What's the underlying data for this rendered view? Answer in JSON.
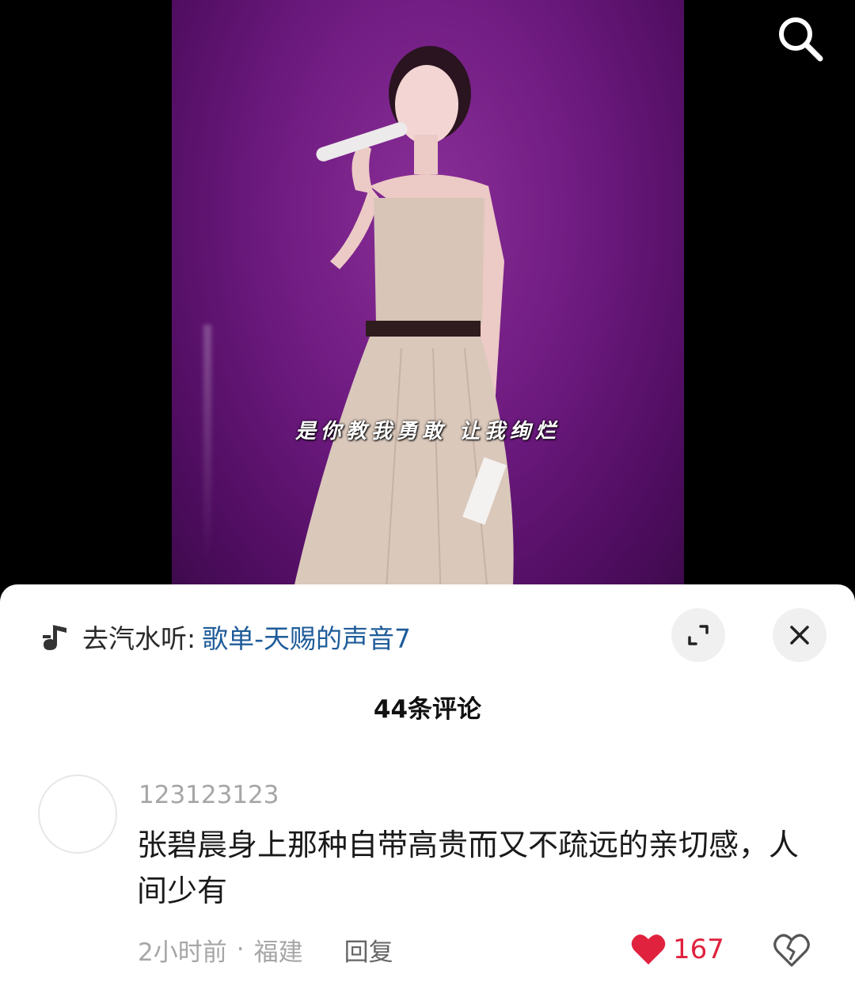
{
  "video": {
    "subtitle": "是你教我勇敢 让我绚烂"
  },
  "music": {
    "prefix": "去汽水听:",
    "playlist": "歌单-天赐的声音7"
  },
  "comments_header": {
    "count_label": "44条评论"
  },
  "comment": {
    "username": "123123123",
    "text": "张碧晨身上那种自带高贵而又不疏远的亲切感，人间少有",
    "time": "2小时前",
    "separator": "·",
    "location": "福建",
    "reply_label": "回复",
    "like_count": "167"
  },
  "colors": {
    "like_red": "#e0223e",
    "link_blue": "#1f5c99",
    "stage_purple": "#6d1a7f"
  },
  "icons": [
    "search-icon",
    "music-note-icon",
    "expand-icon",
    "close-icon",
    "heart-icon",
    "broken-heart-icon"
  ]
}
